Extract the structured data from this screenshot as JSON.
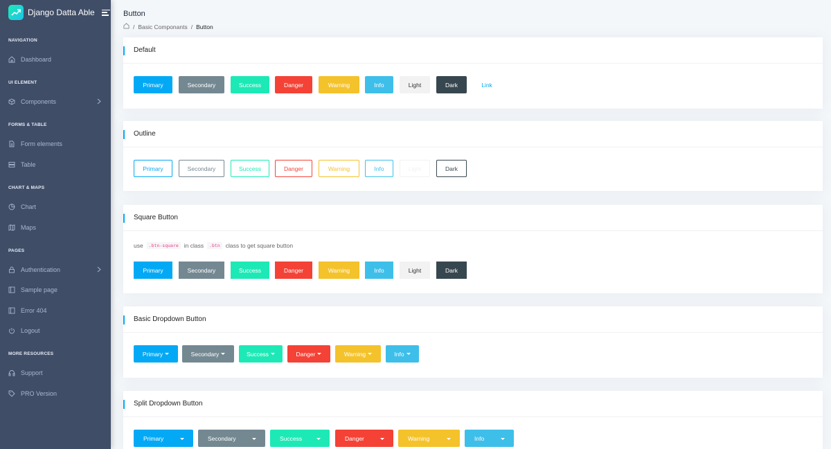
{
  "app": {
    "name": "Django Datta Able"
  },
  "sidebar": {
    "captions": [
      "Navigation",
      "UI Element",
      "Forms & Table",
      "Chart & Maps",
      "Pages",
      "More Resources"
    ],
    "items": [
      {
        "label": "Dashboard",
        "icon": "home-icon"
      },
      {
        "label": "Components",
        "icon": "box-icon",
        "has_arrow": true
      },
      {
        "label": "Form elements",
        "icon": "file-text-icon"
      },
      {
        "label": "Table",
        "icon": "server-icon"
      },
      {
        "label": "Chart",
        "icon": "pie-chart-icon"
      },
      {
        "label": "Maps",
        "icon": "map-icon"
      },
      {
        "label": "Authentication",
        "icon": "lock-icon",
        "has_arrow": true
      },
      {
        "label": "Sample page",
        "icon": "sidebar-icon"
      },
      {
        "label": "Error 404",
        "icon": "sidebar-icon"
      },
      {
        "label": "Logout",
        "icon": "power-icon"
      },
      {
        "label": "Support",
        "icon": "headphones-icon"
      },
      {
        "label": "PRO Version",
        "icon": "tag-icon"
      }
    ]
  },
  "page": {
    "title": "Button",
    "breadcrumb": [
      "Basic Componants",
      "Button"
    ]
  },
  "cards": {
    "default": {
      "title": "Default",
      "buttons": [
        "Primary",
        "Secondary",
        "Success",
        "Danger",
        "Warning",
        "Info",
        "Light",
        "Dark",
        "Link"
      ]
    },
    "outline": {
      "title": "Outline",
      "buttons": [
        "Primary",
        "Secondary",
        "Success",
        "Danger",
        "Warning",
        "Info",
        "Light",
        "Dark"
      ]
    },
    "square": {
      "title": "Square Button",
      "hint": {
        "pre": "use",
        "code1": ".btn-square",
        "mid": "in class",
        "code2": ".btn",
        "post": "class to get square button"
      },
      "buttons": [
        "Primary",
        "Secondary",
        "Success",
        "Danger",
        "Warning",
        "Info",
        "Light",
        "Dark"
      ]
    },
    "dropdown": {
      "title": "Basic Dropdown Button",
      "buttons": [
        "Primary",
        "Secondary",
        "Success",
        "Danger",
        "Warning",
        "Info"
      ]
    },
    "split": {
      "title": "Split Dropdown Button",
      "buttons": [
        "Primary",
        "Secondary",
        "Success",
        "Danger",
        "Warning",
        "Info"
      ]
    }
  },
  "colors": {
    "primary": "#04a9f5",
    "secondary": "#748892",
    "success": "#1de9b6",
    "danger": "#f44236",
    "warning": "#f4c22b",
    "info": "#3ebfea",
    "light": "#f2f2f2",
    "dark": "#37474f",
    "sidebar": "#3f4d67"
  }
}
